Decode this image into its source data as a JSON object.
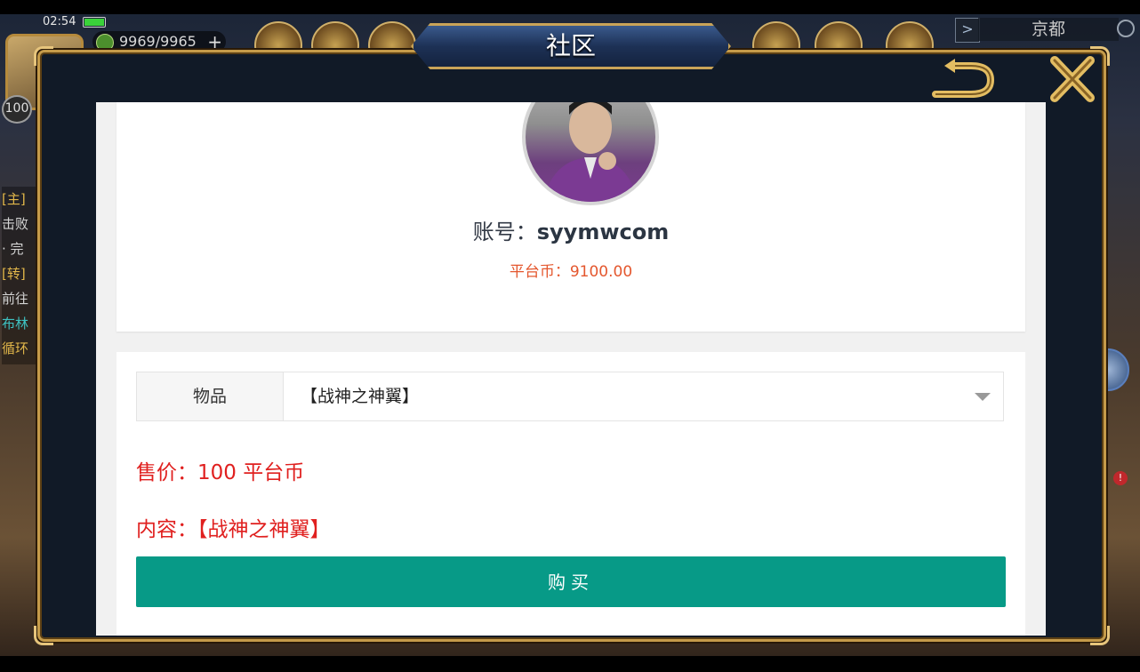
{
  "status": {
    "time": "02:54"
  },
  "hud": {
    "resource": "9969/9965",
    "level": "100",
    "city": "京都",
    "side_task_lines": [
      "[主]",
      "击败",
      "· 完",
      "[转]",
      "前往",
      "布林",
      "循环"
    ]
  },
  "dialog": {
    "title": "社区"
  },
  "profile": {
    "account_label": "账号：",
    "account_value": "syymwcom",
    "coins_text": "平台币：9100.00"
  },
  "trade": {
    "item_label": "物品",
    "item_value": "【战神之神翼】",
    "price_text": "售价：100 平台币",
    "content_text": "内容：【战神之神翼】",
    "buy_label": "购买"
  },
  "colors": {
    "buy_button": "#079a87",
    "price_red": "#e0201f",
    "coins_orange": "#e4572e",
    "frame_gold": "#c59b4a"
  }
}
